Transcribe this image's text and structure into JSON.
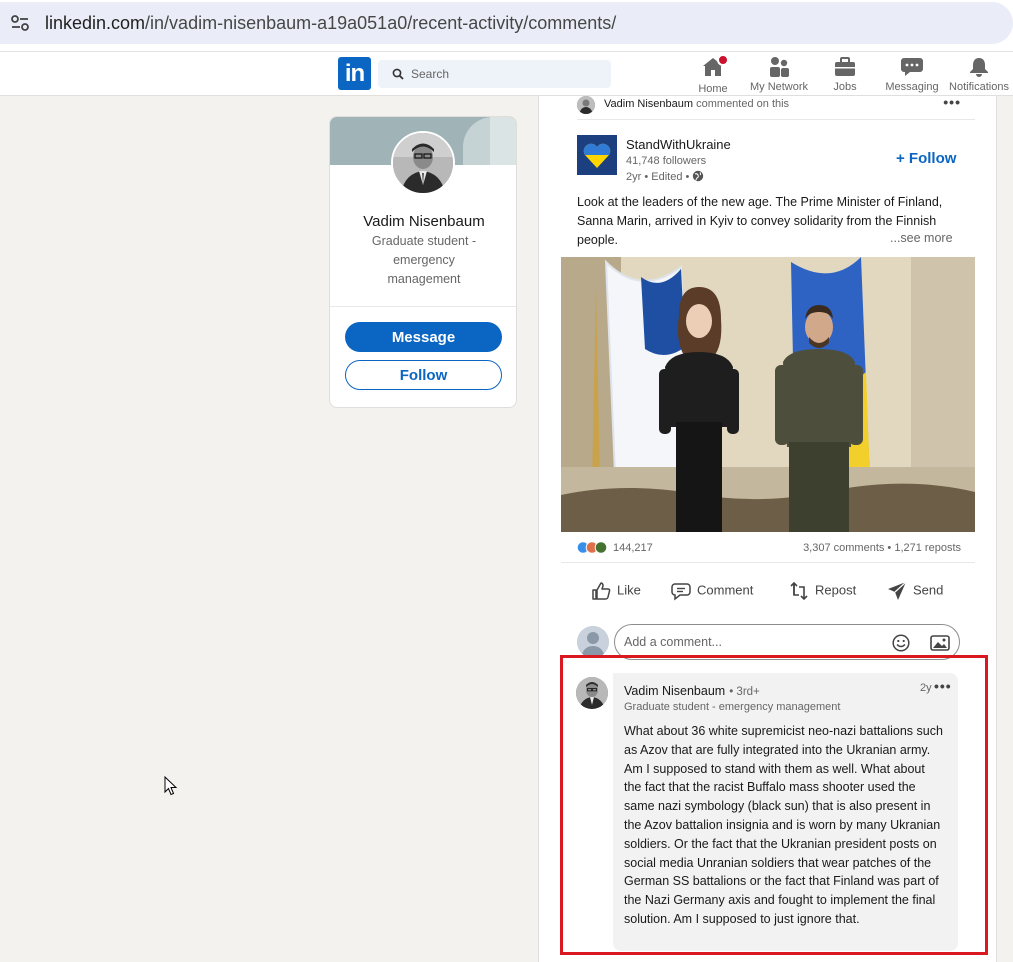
{
  "browser": {
    "url_host": "linkedin.com",
    "url_path": "/in/vadim-nisenbaum-a19a051a0/recent-activity/comments/"
  },
  "nav": {
    "search_placeholder": "Search",
    "items": [
      {
        "label": "Home",
        "icon": "home-icon",
        "has_badge": true
      },
      {
        "label": "My Network",
        "icon": "network-icon"
      },
      {
        "label": "Jobs",
        "icon": "briefcase-icon"
      },
      {
        "label": "Messaging",
        "icon": "chat-icon"
      },
      {
        "label": "Notifications",
        "icon": "bell-icon"
      }
    ],
    "brand_color": "#0a66c2"
  },
  "profile": {
    "name": "Vadim Nisenbaum",
    "headline": "Graduate student - emergency management",
    "message_label": "Message",
    "follow_label": "Follow"
  },
  "activity": {
    "actor": "Vadim Nisenbaum",
    "action": "commented on this"
  },
  "post": {
    "org_name": "StandWithUkraine",
    "followers": "41,748 followers",
    "meta": "2yr • Edited •",
    "follow_label": "+ Follow",
    "text": "Look at the leaders of the new age. The Prime Minister of Finland, Sanna Marin, arrived in Kyiv to convey solidarity from the Finnish people.",
    "see_more": "...see more",
    "reaction_count": "144,217",
    "stats": "3,307 comments • 1,271 reposts",
    "actions": {
      "like": "Like",
      "comment": "Comment",
      "repost": "Repost",
      "send": "Send"
    },
    "comment_placeholder": "Add a comment..."
  },
  "comment": {
    "author": "Vadim Nisenbaum",
    "degree": "• 3rd+",
    "headline": "Graduate student - emergency management",
    "time": "2y",
    "text": "What about 36 white supremicist neo-nazi battalions such as Azov that are fully integrated into the Ukranian army. Am I supposed to stand with them as well. What about the fact that the racist Buffalo mass shooter used the same nazi symbology (black sun) that is also present in the Azov battalion insignia and is worn by many Ukranian soldiers. Or the fact that the Ukranian president posts on social media Unranian soldiers that wear patches of the German SS battalions or the fact that Finland was part of the Nazi Germany axis and fought to implement the final solution. Am I supposed to just ignore that.",
    "highlight_color": "#d9181f"
  }
}
